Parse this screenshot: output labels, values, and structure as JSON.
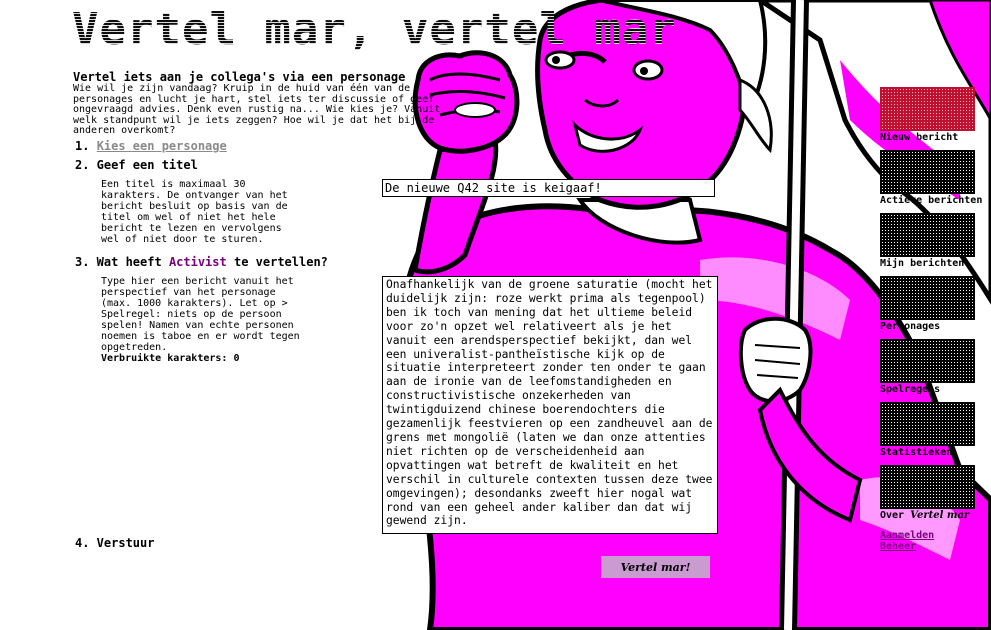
{
  "page": {
    "title": "Vertel mar, vertel mar"
  },
  "intro": {
    "heading": "Vertel iets aan je collega's via een personage",
    "text": "Wie wil je zijn vandaag? Kruip in de huid van één van de personages en lucht je hart, stel iets ter discussie of geef ongevraagd advies. Denk even rustig na... Wie kies je? Vanuit welk standpunt wil je iets zeggen? Hoe wil je dat het bij de anderen overkomt?"
  },
  "steps": {
    "step1_number": "1.",
    "step1_link": "Kies een personage",
    "step2_label": "2. Geef een titel",
    "step2_help": "Een titel is maximaal 30 karakters. De ontvanger van het bericht besluit op basis van de titel om wel of niet het hele bericht te lezen en vervolgens wel of niet door te sturen.",
    "step3_prefix": "3. Wat heeft",
    "step3_accent": "Activist",
    "step3_suffix": "te vertellen?",
    "step3_help": "Type hier een bericht vanuit het perspectief van het personage (max. 1000 karakters). Let op > Spelregel: niets op de persoon spelen! Namen van echte personen noemen is taboe en er wordt tegen opgetreden.",
    "char_count": "Verbruikte karakters: 0",
    "step4_label": "4. Verstuur"
  },
  "form": {
    "title_value": "De nieuwe Q42 site is keigaaf!",
    "message_value": "Onafhankelijk van de groene saturatie (mocht het duidelijk zijn: roze werkt prima als tegenpool) ben ik toch van mening dat het ultieme beleid voor zo'n opzet wel relativeert als je het vanuit een arendsperspectief bekijkt, dan wel een univeralist-pantheïstische kijk op de situatie interpreteert zonder ten onder te gaan aan de ironie van de leefomstandigheden en constructivistische onzekerheden van twintigduizend chinese boerendochters die gezamenlijk feestvieren op een zandheuvel aan de grens met mongolië (laten we dan onze attenties niet richten op de verscheidenheid aan opvattingen wat betreft de kwaliteit en het verschil in culturele contexten tussen deze twee omgevingen); desondanks zweeft hier nogal wat rond van een geheel ander kaliber dan dat wij gewend zijn.",
    "submit_label": "Vertel mar!"
  },
  "sidebar": {
    "items": [
      {
        "label": "Nieuw bericht",
        "active": true
      },
      {
        "label": "Actieve berichten",
        "active": false
      },
      {
        "label": "Mijn berichten",
        "active": false
      },
      {
        "label": "Personages",
        "active": false
      },
      {
        "label": "Spelregels",
        "active": false
      },
      {
        "label": "Statistieken",
        "active": false
      },
      {
        "label_prefix": "Over",
        "label_em": "Vertel mar",
        "active": false
      }
    ],
    "links": [
      "Aanmelden",
      "Beheer"
    ]
  },
  "colors": {
    "accent_magenta": "#ff00ff",
    "accent_purple": "#7a0080",
    "button_bg": "#c99bd0",
    "nav_active": "#c01030"
  }
}
